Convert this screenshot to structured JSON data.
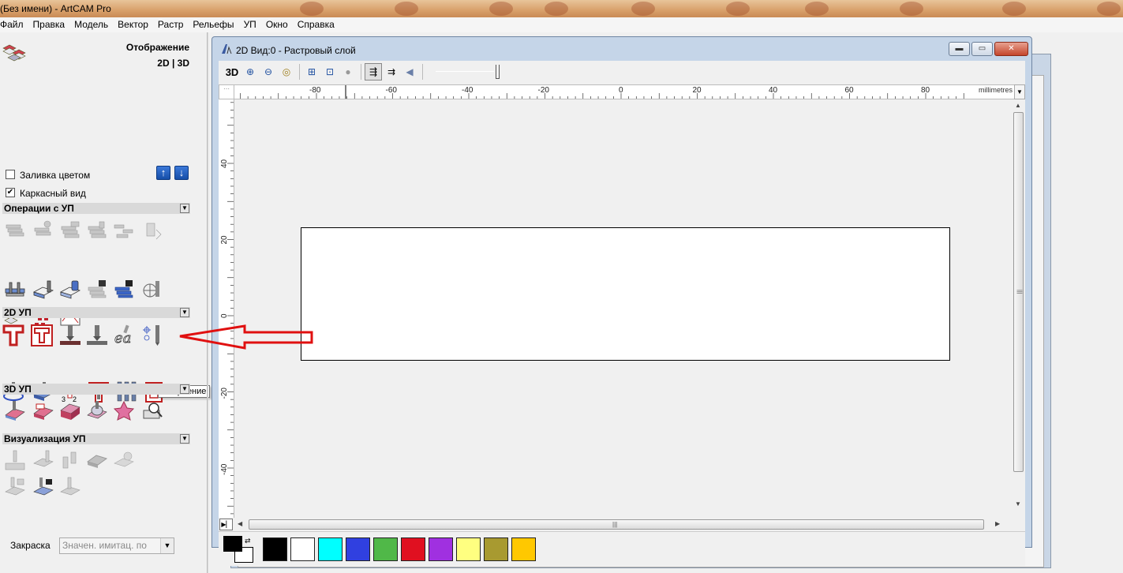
{
  "app": {
    "title": "(Без имени) - ArtCAM Pro"
  },
  "menu": [
    "Файл",
    "Правка",
    "Модель",
    "Вектор",
    "Растр",
    "Рельефы",
    "УП",
    "Окно",
    "Справка"
  ],
  "left_panel": {
    "display_title": "Отображение",
    "display_modes": "2D | 3D",
    "fill_color_label": "Заливка цветом",
    "fill_color_checked": false,
    "wireframe_label": "Каркасный вид",
    "wireframe_checked": true,
    "wireframe_check_glyph": "✔",
    "up_arrow": "↑",
    "down_arrow": "↓",
    "sections": [
      {
        "id": "toolpath_ops",
        "label": "Операции с УП"
      },
      {
        "id": "toolpath_2d",
        "label": "2D УП"
      },
      {
        "id": "toolpath_3d",
        "label": "3D УП"
      },
      {
        "id": "toolpath_sim",
        "label": "Визуализация УП"
      }
    ],
    "dropdown_glyph": "▼",
    "tooltip": "Сверление",
    "shading_label": "Закраска",
    "shading_value": "Значен. имитац. по",
    "shading_arrow": "▼"
  },
  "document": {
    "title": "2D Вид:0 - Растровый слой",
    "win_minimize": "▬",
    "win_maximize": "▭",
    "win_close": "✕",
    "toolbar": {
      "view3d": "3D",
      "zoom_in": "⊕",
      "zoom_out": "⊖",
      "zoom_prev": "◎",
      "zoom_fit": "⊞",
      "zoom_box": "⊡",
      "zoom_all": "●",
      "tool_a": "⇶",
      "tool_b": "⇉",
      "tool_c": "◀"
    },
    "ruler_unit": "millimetres",
    "ruler_dropdown": "▼",
    "ruler_corner": "⋯",
    "h_ruler_labels": [
      "-80",
      "-60",
      "-40",
      "-20",
      "0",
      "20",
      "40",
      "60",
      "80"
    ],
    "v_ruler_labels": [
      "40",
      "20",
      "0",
      "-20",
      "-40"
    ],
    "scroll_up": "▲",
    "scroll_down": "▼",
    "scroll_left": "◀",
    "scroll_right": "▶",
    "scroll_grip": "|||",
    "zoom_btn": "▶▏",
    "swap_glyph": "⇄"
  },
  "palette": {
    "foreground": "#000000",
    "background": "#ffffff",
    "swatches": [
      "#000000",
      "#ffffff",
      "#00ffff",
      "#3040e0",
      "#50b848",
      "#e01020",
      "#a030e0",
      "#ffff80",
      "#a89a30",
      "#ffc800"
    ]
  },
  "colors": {
    "annotation_arrow": "#e01010",
    "title_gradient": "#d8a06a"
  }
}
